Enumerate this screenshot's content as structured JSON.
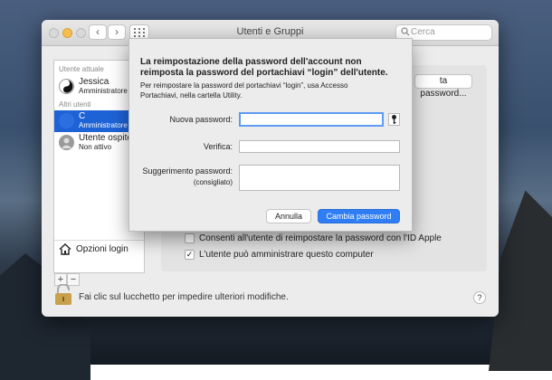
{
  "window": {
    "title": "Utenti e Gruppi"
  },
  "nav": {
    "back": "‹",
    "forward": "›",
    "grid_icon": "grid-icon"
  },
  "search": {
    "placeholder": "Cerca"
  },
  "sidebar": {
    "current_user_header": "Utente attuale",
    "current_user": {
      "name": "Jessica",
      "role": "Amministratore"
    },
    "other_users_header": "Altri utenti",
    "selected_user": {
      "name": "C",
      "role": "Amministratore"
    },
    "guest_user": {
      "name": "Utente ospite",
      "role": "Non attivo"
    },
    "login_options": "Opzioni login",
    "add": "+",
    "remove": "−"
  },
  "pane": {
    "change_password_button": "ta password...",
    "checkbox_reset_appleid": {
      "label": "Consenti all'utente di reimpostare la password con l'ID Apple",
      "checked": false
    },
    "checkbox_admin": {
      "label": "L'utente può amministrare questo computer",
      "checked": true,
      "mark": "✓"
    }
  },
  "lock": {
    "text": "Fai clic sul lucchetto per impedire ulteriori modifiche."
  },
  "help": "?",
  "sheet": {
    "title": "La reimpostazione della password dell'account non reimposta la password del portachiavi “login” dell'utente.",
    "description": "Per reimpostare la password del portachiavi “login”, usa Accesso Portachiavi, nella cartella Utility.",
    "new_password_label": "Nuova password:",
    "new_password_value": "",
    "verify_label": "Verifica:",
    "verify_value": "",
    "hint_label": "Suggerimento password:",
    "hint_sublabel": "(consigliato)",
    "hint_value": "",
    "cancel": "Annulla",
    "confirm": "Cambia password"
  },
  "colors": {
    "accent": "#1e63d6",
    "primary_button": "#2f7ef5",
    "focus_ring": "#5e9bf2"
  }
}
